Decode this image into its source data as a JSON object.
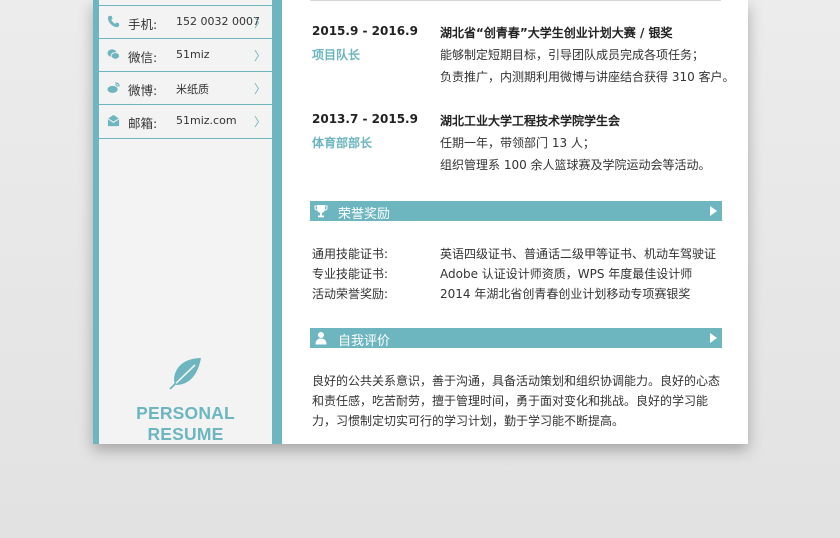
{
  "contacts": [
    {
      "label": "手机:",
      "value": "152 0032 0007",
      "icon": "phone-icon"
    },
    {
      "label": "微信:",
      "value": "51miz",
      "icon": "wechat-icon"
    },
    {
      "label": "微博:",
      "value": "米纸质",
      "icon": "weibo-icon"
    },
    {
      "label": "邮箱:",
      "value": "51miz.com",
      "icon": "mail-icon"
    }
  ],
  "chevron": "〉",
  "brand": "PERSONAL RESUME",
  "experiences": [
    {
      "period": "2015.9 - 2016.9",
      "role": "项目队长",
      "org": "湖北省“创青春”大学生创业计划大赛 / 银奖",
      "details": [
        "能够制定短期目标，引导团队成员完成各项任务；",
        "负责推广，内测期利用微博与讲座结合获得 310 客户。"
      ]
    },
    {
      "period": "2013.7 - 2015.9",
      "role": "体育部部长",
      "org": "湖北工业大学工程技术学院学生会",
      "details": [
        "任期一年，带领部门 13 人；",
        "组织管理系 100 余人篮球赛及学院运动会等活动。"
      ]
    }
  ],
  "honors": {
    "title": "荣誉奖励",
    "icon": "trophy-icon",
    "items": [
      {
        "key": "通用技能证书:",
        "value": "英语四级证书、普通话二级甲等证书、机动车驾驶证"
      },
      {
        "key": "专业技能证书:",
        "value": "Adobe 认证设计师资质，WPS 年度最佳设计师"
      },
      {
        "key": "活动荣誉奖励:",
        "value": "2014 年湖北省创青春创业计划移动专项赛银奖"
      }
    ]
  },
  "self_eval": {
    "title": "自我评价",
    "icon": "person-icon",
    "lines": [
      "良好的公共关系意识，善于沟通，具备活动策划和组织协调能力。良好的心态",
      "和责任感，吃苦耐劳，擅于管理时间，勇于面对变化和挑战。良好的学习能",
      "力，习惯制定切实可行的学习计划，勤于学习能不断提高。"
    ]
  },
  "colors": {
    "accent": "#6db6bf",
    "text": "#333333",
    "sidebar_bg": "#f3f3f3"
  }
}
